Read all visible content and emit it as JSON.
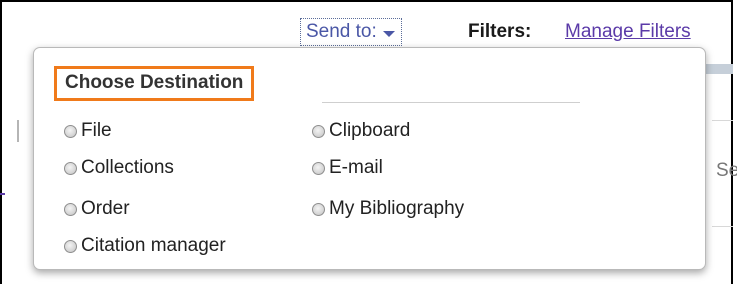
{
  "toolbar": {
    "send_to_label": "Send to:",
    "filters_label": "Filters:",
    "manage_filters_link": "Manage Filters"
  },
  "background": {
    "peek_text": "Se"
  },
  "destination_popup": {
    "title": "Choose Destination",
    "options": [
      {
        "label": "File",
        "selected": false
      },
      {
        "label": "Collections",
        "selected": false
      },
      {
        "label": "Order",
        "selected": false
      },
      {
        "label": "Citation manager",
        "selected": false
      },
      {
        "label": "Clipboard",
        "selected": false
      },
      {
        "label": "E-mail",
        "selected": false
      },
      {
        "label": "My Bibliography",
        "selected": false
      }
    ]
  },
  "colors": {
    "highlight_border": "#f07a1a",
    "link": "#4a57a6",
    "visited_link": "#5b3aa8"
  }
}
